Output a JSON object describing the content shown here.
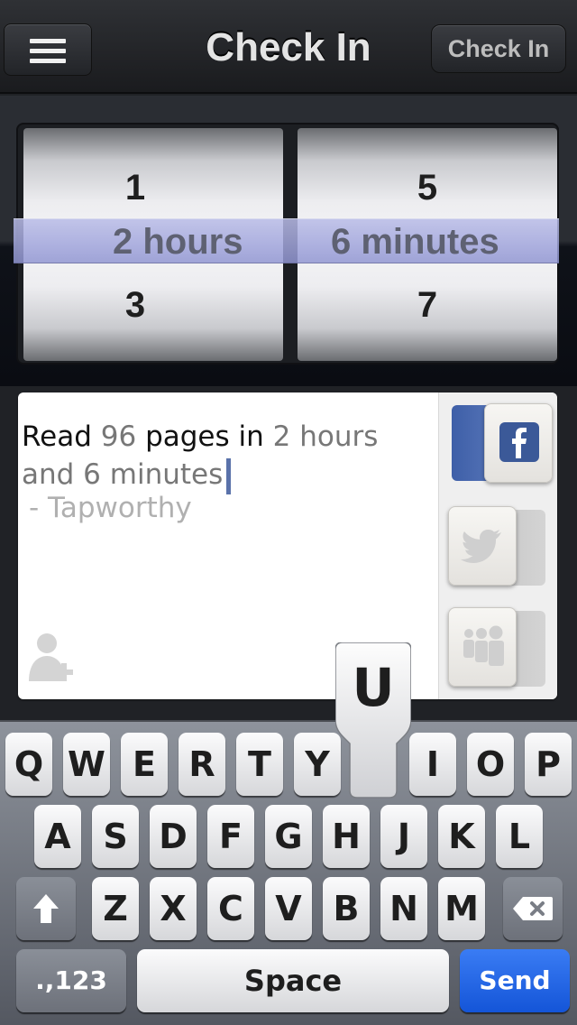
{
  "nav": {
    "title": "Check In",
    "action_label": "Check In"
  },
  "picker": {
    "hours": {
      "above": "1",
      "selected": "2 hours",
      "below": "3"
    },
    "minutes": {
      "above": "5",
      "selected": "6 minutes",
      "below": "7"
    }
  },
  "composer": {
    "read": "Read",
    "pages": "96",
    "pages_in": "pages in",
    "duration": "2 hours and 6 minutes",
    "attribution": "- Tapworthy"
  },
  "share": {
    "facebook": {
      "icon": "facebook-icon",
      "on": true,
      "accent": "#3b5998"
    },
    "twitter": {
      "icon": "twitter-icon",
      "on": false
    },
    "myspace": {
      "icon": "myspace-icon",
      "on": false
    }
  },
  "keyboard": {
    "row1": [
      "Q",
      "W",
      "E",
      "R",
      "T",
      "Y",
      "U",
      "I",
      "O",
      "P"
    ],
    "row2": [
      "A",
      "S",
      "D",
      "F",
      "G",
      "H",
      "J",
      "K",
      "L"
    ],
    "row3": [
      "Z",
      "X",
      "C",
      "V",
      "B",
      "N",
      "M"
    ],
    "numbers_label": ".,123",
    "space_label": "Space",
    "send_label": "Send",
    "pressed_key": "U"
  }
}
